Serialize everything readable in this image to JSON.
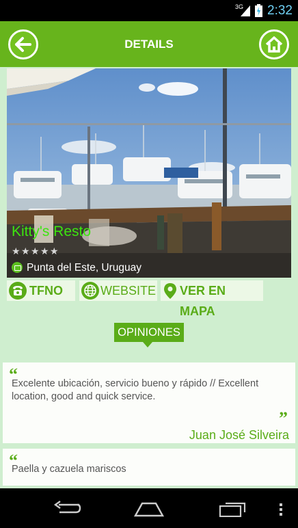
{
  "status_bar": {
    "network": "3G",
    "time": "2:32"
  },
  "header": {
    "title": "DETAILS",
    "back_icon": "arrow-left-icon",
    "home_icon": "home-icon"
  },
  "place": {
    "name": "Kitty's Resto",
    "rating": 0,
    "rating_max": 5,
    "location": "Punta del Este, Uruguay"
  },
  "actions": {
    "phone": "TFNO",
    "website": "WEBSITE",
    "map": "VER EN MAPA"
  },
  "opinions": {
    "heading": "OPINIONES",
    "reviews": [
      {
        "text": "Excelente ubicación, servicio bueno y rápido // Excellent location, good and quick service.",
        "author": "Juan José Silveira"
      },
      {
        "text": "Paella y cazuela mariscos",
        "author": ""
      }
    ]
  },
  "colors": {
    "accent": "#67b41c",
    "dark_green": "#5aac18",
    "background": "#cfeecf",
    "name_green": "#3ce60e"
  }
}
